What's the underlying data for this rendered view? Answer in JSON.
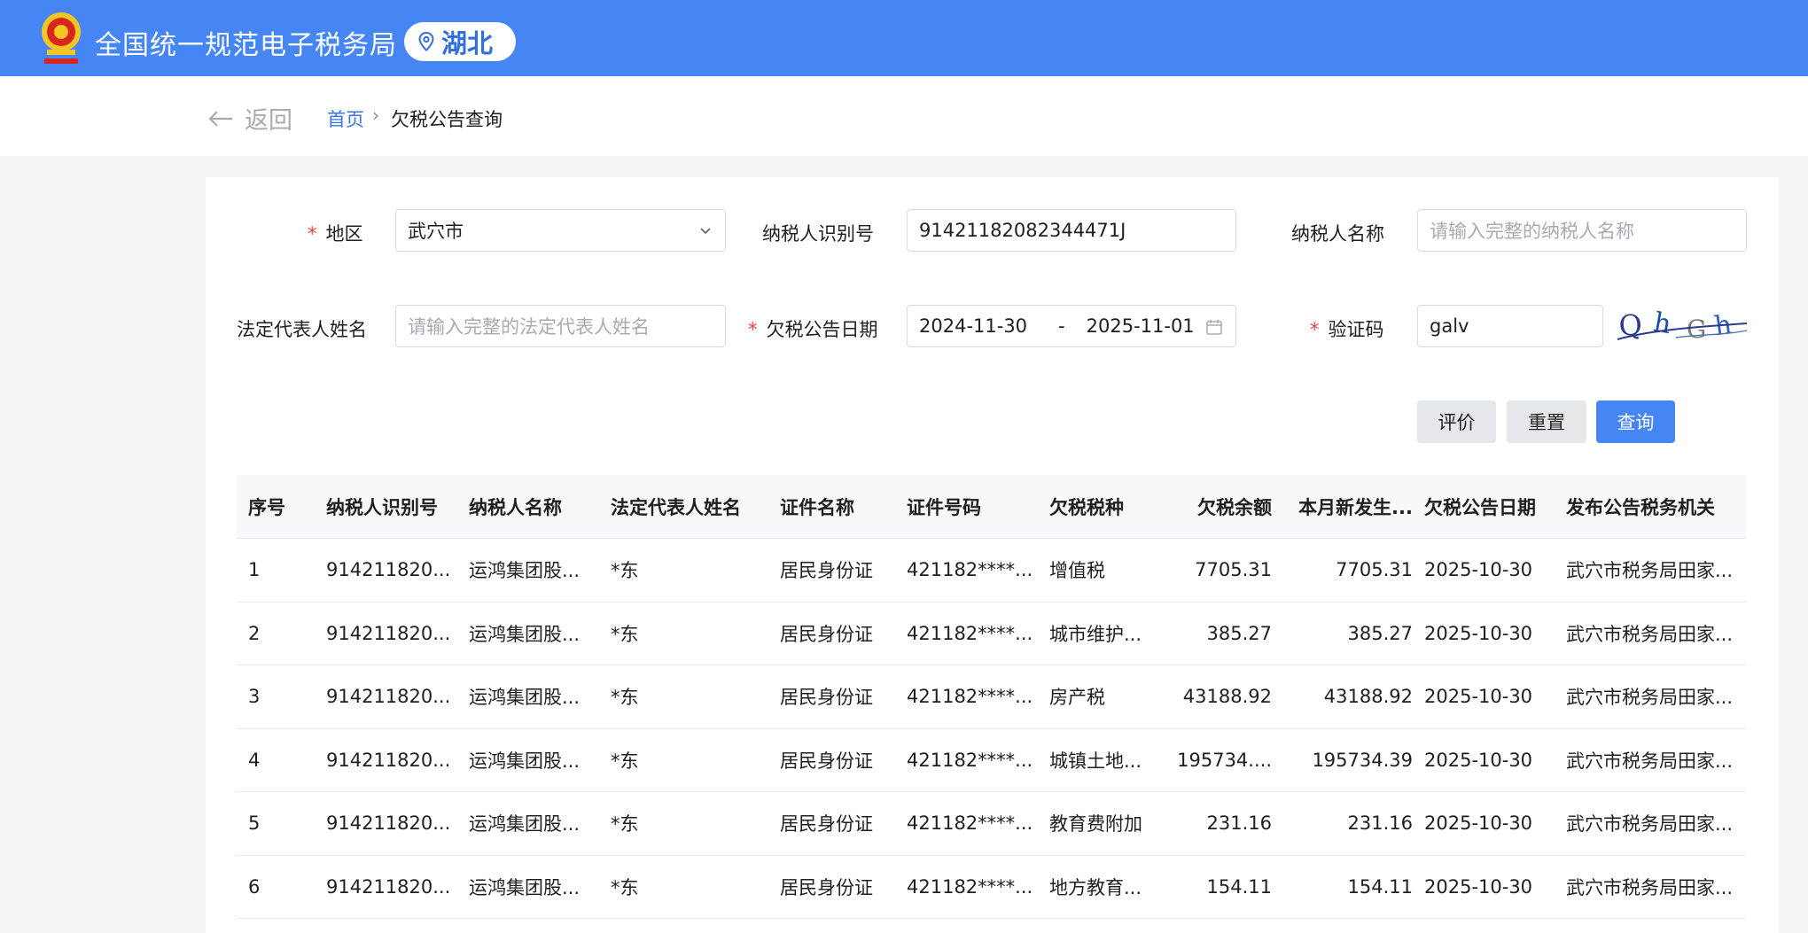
{
  "header": {
    "site_title": "全国统一规范电子税务局",
    "region": "湖北",
    "brand_color": "#4586f4"
  },
  "nav": {
    "back_label": "返回",
    "breadcrumb_home": "首页",
    "breadcrumb_sep": "›",
    "breadcrumb_current": "欠税公告查询"
  },
  "form": {
    "region_label": "地区",
    "region_value": "武穴市",
    "taxpayer_id_label": "纳税人识别号",
    "taxpayer_id_value": "91421182082344471J",
    "taxpayer_name_label": "纳税人名称",
    "taxpayer_name_placeholder": "请输入完整的纳税人名称",
    "legal_rep_label": "法定代表人姓名",
    "legal_rep_placeholder": "请输入完整的法定代表人姓名",
    "date_label": "欠税公告日期",
    "date_start": "2024-11-30",
    "date_sep": "-",
    "date_end": "2025-11-01",
    "captcha_label": "验证码",
    "captcha_value": "galv",
    "required_mark": "*"
  },
  "buttons": {
    "evaluate": "评价",
    "reset": "重置",
    "query": "查询"
  },
  "table": {
    "columns": [
      "序号",
      "纳税人识别号",
      "纳税人名称",
      "法定代表人姓名",
      "证件名称",
      "证件号码",
      "欠税税种",
      "欠税余额",
      "本月新发生...",
      "欠税公告日期",
      "发布公告税务机关"
    ],
    "rows": [
      [
        "1",
        "914211820...",
        "运鸿集团股...",
        "*东",
        "居民身份证",
        "421182****...",
        "增值税",
        "7705.31",
        "7705.31",
        "2025-10-30",
        "武穴市税务局田家..."
      ],
      [
        "2",
        "914211820...",
        "运鸿集团股...",
        "*东",
        "居民身份证",
        "421182****...",
        "城市维护...",
        "385.27",
        "385.27",
        "2025-10-30",
        "武穴市税务局田家..."
      ],
      [
        "3",
        "914211820...",
        "运鸿集团股...",
        "*东",
        "居民身份证",
        "421182****...",
        "房产税",
        "43188.92",
        "43188.92",
        "2025-10-30",
        "武穴市税务局田家..."
      ],
      [
        "4",
        "914211820...",
        "运鸿集团股...",
        "*东",
        "居民身份证",
        "421182****...",
        "城镇土地...",
        "195734....",
        "195734.39",
        "2025-10-30",
        "武穴市税务局田家..."
      ],
      [
        "5",
        "914211820...",
        "运鸿集团股...",
        "*东",
        "居民身份证",
        "421182****...",
        "教育费附加",
        "231.16",
        "231.16",
        "2025-10-30",
        "武穴市税务局田家..."
      ],
      [
        "6",
        "914211820...",
        "运鸿集团股...",
        "*东",
        "居民身份证",
        "421182****...",
        "地方教育...",
        "154.11",
        "154.11",
        "2025-10-30",
        "武穴市税务局田家..."
      ]
    ]
  }
}
